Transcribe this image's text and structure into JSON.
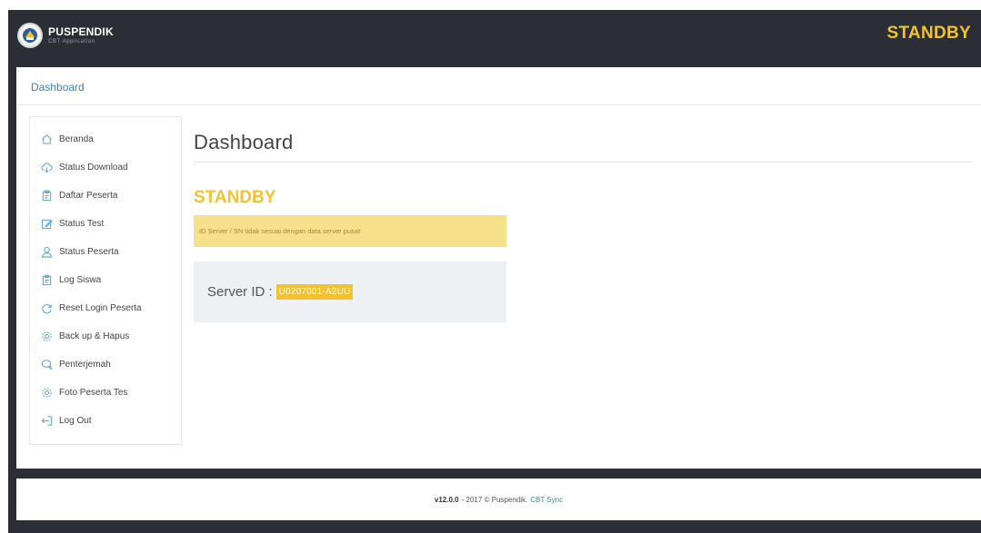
{
  "app": {
    "brand_name": "PUSPENDIK",
    "brand_sub": "CBT Application",
    "status": "STANDBY"
  },
  "breadcrumb": {
    "label": "Dashboard"
  },
  "sidebar": {
    "items": [
      {
        "label": "Beranda",
        "icon": "home-icon"
      },
      {
        "label": "Status Download",
        "icon": "cloud-download-icon"
      },
      {
        "label": "Daftar Peserta",
        "icon": "clipboard-icon"
      },
      {
        "label": "Status Test",
        "icon": "edit-icon"
      },
      {
        "label": "Status Peserta",
        "icon": "user-icon"
      },
      {
        "label": "Log Siswa",
        "icon": "clipboard-icon"
      },
      {
        "label": "Reset Login Peserta",
        "icon": "refresh-icon"
      },
      {
        "label": "Back up & Hapus",
        "icon": "gear-icon"
      },
      {
        "label": "Penterjemah",
        "icon": "chat-icon"
      },
      {
        "label": "Foto Peserta Tes",
        "icon": "gear-icon"
      },
      {
        "label": "Log Out",
        "icon": "logout-icon"
      }
    ]
  },
  "main": {
    "title": "Dashboard",
    "status_heading": "STANDBY",
    "alert_text": "ID Server / SN tidak sesuai dengan data server pusat",
    "server_label": "Server ID :",
    "server_id": "U0207001-A2UU"
  },
  "footer": {
    "version": "v12.0.0",
    "copyright": "- 2017 © Puspendik.",
    "link": "CBT Sync"
  },
  "colors": {
    "navbar": "#2b2f35",
    "accent": "#f2c230",
    "alert_bg": "#f6e08c",
    "link": "#3f7fb0"
  }
}
